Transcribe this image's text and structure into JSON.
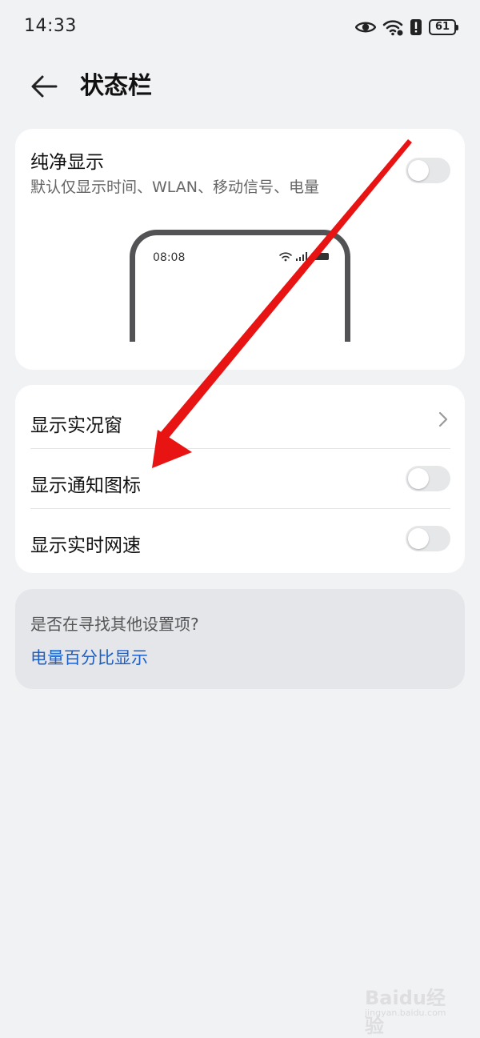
{
  "status_bar": {
    "time": "14:33",
    "battery": "61",
    "icons": [
      "eye-icon",
      "wifi-icon",
      "alert-icon",
      "battery-icon"
    ]
  },
  "header": {
    "title": "状态栏",
    "back_icon": "arrow-left-icon"
  },
  "pure_display": {
    "title": "纯净显示",
    "subtitle": "默认仅显示时间、WLAN、移动信号、电量",
    "enabled": false,
    "illustration_time": "08:08"
  },
  "settings": {
    "rows": [
      {
        "label": "显示实况窗",
        "control": "chevron"
      },
      {
        "label": "显示通知图标",
        "control": "toggle",
        "enabled": false
      },
      {
        "label": "显示实时网速",
        "control": "toggle",
        "enabled": false
      }
    ]
  },
  "hint": {
    "question": "是否在寻找其他设置项?",
    "link": "电量百分比显示"
  },
  "watermark": {
    "main": "Baidu经验",
    "sub": "jingyan.baidu.com"
  },
  "colors": {
    "background": "#f1f2f4",
    "card": "#ffffff",
    "link": "#1d5fc4",
    "annotation_arrow": "#e81313"
  }
}
